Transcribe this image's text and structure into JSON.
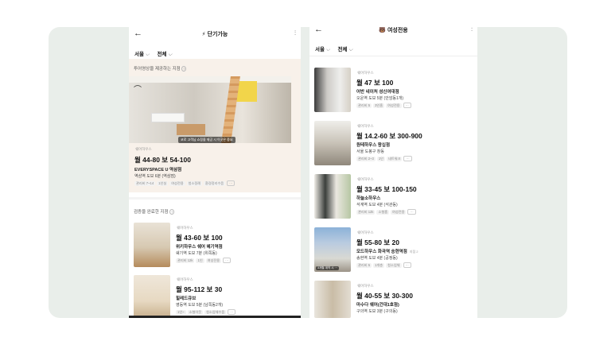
{
  "left": {
    "back_icon": "←",
    "title_icon": "⚡",
    "title": "단기가능",
    "filter_icon": "⫶",
    "chips": [
      {
        "label": "서울",
        "chev": "⌵"
      },
      {
        "label": "전체",
        "chev": "⌵"
      }
    ],
    "section1_title": "투어영상을 제공하는 지점",
    "q_icon": "?",
    "featured": {
      "caption": "코로 고객님 쇼핑몰 제공 시 이곳은 중요",
      "tag": "쉐어하우스",
      "price": "월 44-80   보 54-100",
      "name": "EVERYSPACE U 역삼점",
      "loc": "역삼역 도보 6분 (역삼점)",
      "features": [
        "관리비 7~14",
        "1인실",
        "여성전용",
        "청소정례",
        "환경정리수음"
      ],
      "more": "···"
    },
    "section2_title": "검증을 완료한 지점",
    "listings": [
      {
        "tag": "쉐어하우스",
        "price": "월 43-60   보 100",
        "name": "위키하우스 쉐어 혜기역점",
        "loc": "쉐기역 도보 7분 (위쪽동)",
        "features": [
          "관리비 12k",
          "1인",
          "여성전용"
        ],
        "more": "···"
      },
      {
        "tag": "쉐어하우스",
        "price": "월 95-112   보 30",
        "name": "힐레드큐브",
        "loc": "영등역 도보 5분 (남쪽동2개)",
        "features": [
          "1인~",
          "소형이웃",
          "청소업체수음"
        ],
        "more": "···"
      }
    ]
  },
  "right": {
    "back_icon": "←",
    "title_icon": "🐻",
    "title": "여성전용",
    "filter_icon": "⫶",
    "chips": [
      {
        "label": "서울",
        "chev": "⌵"
      },
      {
        "label": "전체",
        "chev": "⌵"
      }
    ],
    "listings": [
      {
        "tag": "쉐어하우스",
        "price": "월 47   보 100",
        "name": "어반 네이처 성신여대점",
        "loc": "오운역 도보 5분 (안암동1개)",
        "features": [
          "관리비 5",
          "3인흡",
          "여성전용"
        ],
        "more": "···",
        "badge": "",
        "sub": ""
      },
      {
        "tag": "쉐어하우스",
        "price": "월 14.2-60   보 300-900",
        "name": "원테하우스 왕십점",
        "loc": "서울 도봉구 창동",
        "features": [
          "관리비 2~3",
          "1인",
          "네트워크"
        ],
        "more": "···",
        "badge": "",
        "sub": ""
      },
      {
        "tag": "쉐어하우스",
        "price": "월 33-45   보 100-150",
        "name": "하늘소하우스",
        "loc": "석계역 도보 4분 (석관동)",
        "features": [
          "관리비 12k",
          "소형흡",
          "여성전용"
        ],
        "more": "···",
        "badge": "",
        "sub": ""
      },
      {
        "tag": "쉐어하우스",
        "price": "월 55-80   보 20",
        "name": "모드하우스 화곡역 송현역점",
        "loc": "송현역 도보 4분 (공정동)",
        "features": [
          "관리비 5",
          "1개층",
          "청소업체"
        ],
        "more": "···",
        "badge": "3개월 계약 시 ···",
        "sub": "지점 2"
      },
      {
        "tag": "쉐어하우스",
        "price": "월 40-55   보 30-300",
        "name": "마수다 쉐어(건대1호점)",
        "loc": "구의역 도보 3분 (구의동)",
        "features": [],
        "more": "",
        "badge": "",
        "sub": ""
      }
    ]
  },
  "colors": {
    "stage_bg": "#e9eeea",
    "highlight_bg": "#f8f1ea",
    "price": "#111111"
  }
}
